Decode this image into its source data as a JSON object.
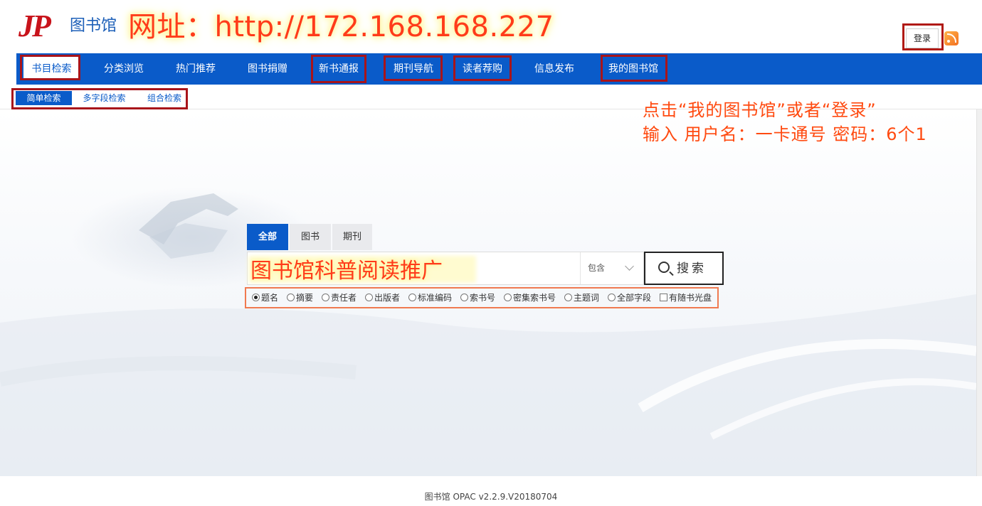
{
  "header": {
    "logo_mark": "JP",
    "logo_text": "图书馆",
    "url_banner": "网址：http://172.168.168.227",
    "login_label": "登录"
  },
  "nav": {
    "items": [
      {
        "label": "书目检索"
      },
      {
        "label": "分类浏览"
      },
      {
        "label": "热门推荐"
      },
      {
        "label": "图书捐赠"
      },
      {
        "label": "新书通报"
      },
      {
        "label": "期刊导航"
      },
      {
        "label": "读者荐购"
      },
      {
        "label": "信息发布"
      },
      {
        "label": "我的图书馆"
      }
    ],
    "active_index": 0
  },
  "subnav": {
    "items": [
      {
        "label": "简单检索"
      },
      {
        "label": "多字段检索"
      },
      {
        "label": "组合检索"
      }
    ],
    "active_index": 0
  },
  "instructions": {
    "line1": "点击“我的图书馆”或者“登录”",
    "line2": "输入 用户名：一卡通号  密码：6个1"
  },
  "search": {
    "tabs": [
      {
        "label": "全部"
      },
      {
        "label": "图书"
      },
      {
        "label": "期刊"
      }
    ],
    "active_tab": 0,
    "input_value": "图书馆科普阅读推广",
    "match_mode": "包含",
    "button_label": "搜索",
    "options": [
      {
        "label": "题名",
        "type": "radio",
        "checked": true
      },
      {
        "label": "摘要",
        "type": "radio",
        "checked": false
      },
      {
        "label": "责任者",
        "type": "radio",
        "checked": false
      },
      {
        "label": "出版者",
        "type": "radio",
        "checked": false
      },
      {
        "label": "标准编码",
        "type": "radio",
        "checked": false
      },
      {
        "label": "索书号",
        "type": "radio",
        "checked": false
      },
      {
        "label": "密集索书号",
        "type": "radio",
        "checked": false
      },
      {
        "label": "主题词",
        "type": "radio",
        "checked": false
      },
      {
        "label": "全部字段",
        "type": "radio",
        "checked": false
      },
      {
        "label": "有随书光盘",
        "type": "checkbox",
        "checked": false
      }
    ]
  },
  "footer": {
    "text": "图书馆  OPAC v2.2.9.V20180704"
  },
  "colors": {
    "nav_blue": "#0a5bc9",
    "annotation_red": "#ff3b1a",
    "frame_red": "#a8141a"
  }
}
